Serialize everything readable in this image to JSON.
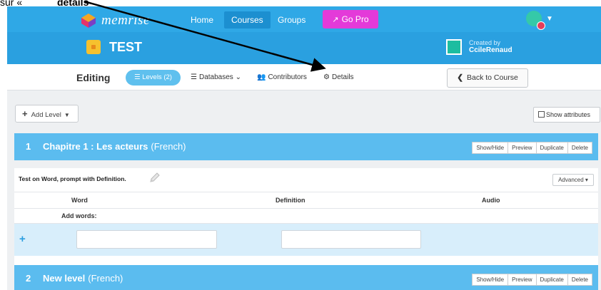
{
  "instruction": {
    "prefix": "sur « ",
    "word": "détails"
  },
  "topnav": {
    "logo_text": "memrise",
    "items": [
      "Home",
      "Courses",
      "Groups"
    ],
    "active_item": "Courses",
    "go_pro": "Go Pro",
    "brand_color": "#2fa8e6",
    "go_pro_color": "#e43ad9"
  },
  "course": {
    "title": "TEST",
    "created_by_label": "Created by",
    "creator_name": "CcileRenaud"
  },
  "edit_bar": {
    "editing_label": "Editing",
    "levels_tab": "Levels (2)",
    "databases_tab": "Databases",
    "contributors_tab": "Contributors",
    "details_tab": "Details",
    "back_button": "Back to Course"
  },
  "toolbar": {
    "add_level": "Add Level",
    "show_attributes": "Show attributes"
  },
  "levels": [
    {
      "number": "1",
      "name": "Chapitre 1 : Les acteurs",
      "language": "(French)",
      "buttons": [
        "Show/Hide",
        "Preview",
        "Duplicate",
        "Delete"
      ],
      "test_prompt": "Test on Word, prompt with Definition.",
      "advanced": "Advanced",
      "columns": [
        "Word",
        "Definition",
        "Audio"
      ],
      "add_words_label": "Add words:"
    },
    {
      "number": "2",
      "name": "New level",
      "language": "(French)",
      "buttons": [
        "Show/Hide",
        "Preview",
        "Duplicate",
        "Delete"
      ]
    }
  ]
}
